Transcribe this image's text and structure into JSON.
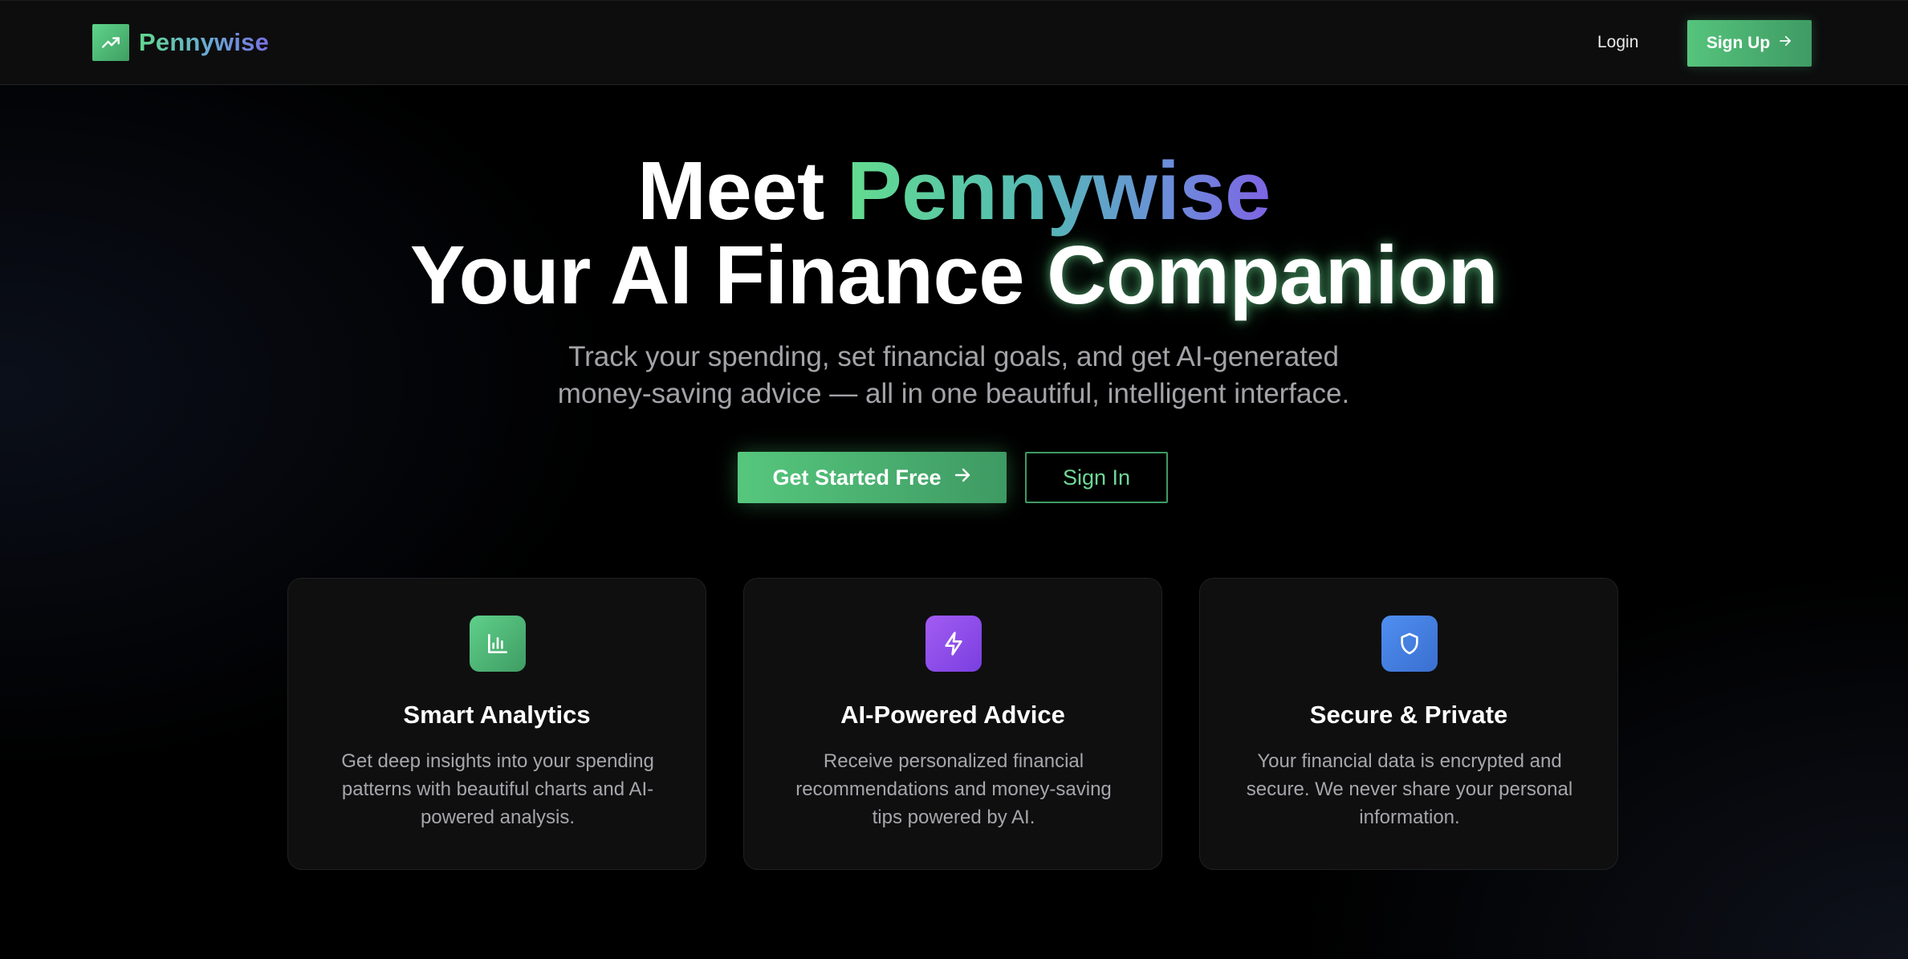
{
  "header": {
    "brand_name": "Pennywise",
    "brand_icon": "trending-up-icon",
    "login_label": "Login",
    "signup_label": "Sign Up"
  },
  "hero": {
    "title_prefix": "Meet ",
    "title_accent": "Pennywise",
    "subtitle_main": "Your AI Finance ",
    "subtitle_glow": "Companion",
    "description_line1": "Track your spending, set financial goals, and get AI-generated",
    "description_line2": "money-saving advice — all in one beautiful, intelligent interface.",
    "primary_cta": "Get Started Free",
    "secondary_cta": "Sign In"
  },
  "features": [
    {
      "icon": "bar-chart-icon",
      "title": "Smart Analytics",
      "description": "Get deep insights into your spending patterns with beautiful charts and AI-powered analysis."
    },
    {
      "icon": "lightning-icon",
      "title": "AI-Powered Advice",
      "description": "Receive personalized financial recommendations and money-saving tips powered by AI."
    },
    {
      "icon": "shield-icon",
      "title": "Secure & Private",
      "description": "Your financial data is encrypted and secure. We never share your personal information."
    }
  ],
  "colors": {
    "brand_green": "#56c77d",
    "brand_green_dark": "#3e9a63",
    "accent_purple": "#7a3fe0",
    "accent_blue": "#4f8ff0",
    "background": "#000000"
  }
}
